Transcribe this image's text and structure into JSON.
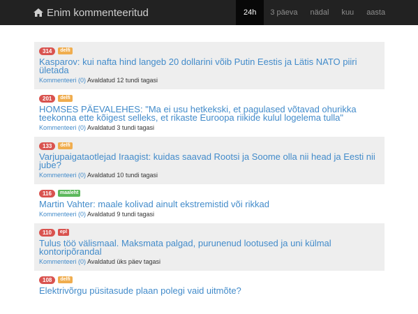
{
  "navbar": {
    "brand": "Enim kommenteeritud",
    "tabs": [
      "24h",
      "3 päeva",
      "nädal",
      "kuu",
      "aasta"
    ],
    "active_tab": "24h"
  },
  "colors": {
    "delfi": "#f0ad4e",
    "maaleht": "#5cb85c",
    "epl": "#d9534f"
  },
  "articles": [
    {
      "count": "314",
      "source": "delfi",
      "title": "Kasparov: kui nafta hind langeb 20 dollarini võib Putin Eestis ja Lätis NATO piiri ületada",
      "comments": "Kommenteeri (0)",
      "published": "Avaldatud 12 tundi tagasi"
    },
    {
      "count": "201",
      "source": "delfi",
      "title": "HOMSES PÄEVALEHES: \"Ma ei usu hetkekski, et pagulased võtavad ohurikka teekonna ette kõigest selleks, et rikaste Euroopa riikide kulul logelema tulla\"",
      "comments": "Kommenteeri (0)",
      "published": "Avaldatud 3 tundi tagasi"
    },
    {
      "count": "133",
      "source": "delfi",
      "title": "Varjupaigataotlejad Iraagist: kuidas saavad Rootsi ja Soome olla nii head ja Eesti nii jube?",
      "comments": "Kommenteeri (0)",
      "published": "Avaldatud 10 tundi tagasi"
    },
    {
      "count": "116",
      "source": "maaleht",
      "title": "Martin Vahter: maale kolivad ainult ekstremistid või rikkad",
      "comments": "Kommenteeri (0)",
      "published": "Avaldatud 9 tundi tagasi"
    },
    {
      "count": "110",
      "source": "epl",
      "title": "Tulus töö välismaal. Maksmata palgad, purunenud lootused ja uni külmal kontoripõrandal",
      "comments": "Kommenteeri (0)",
      "published": "Avaldatud üks päev tagasi"
    },
    {
      "count": "108",
      "source": "delfi",
      "title": "Elektrivõrgu püsitasude plaan polegi vaid uitmõte?",
      "comments": "",
      "published": ""
    }
  ]
}
